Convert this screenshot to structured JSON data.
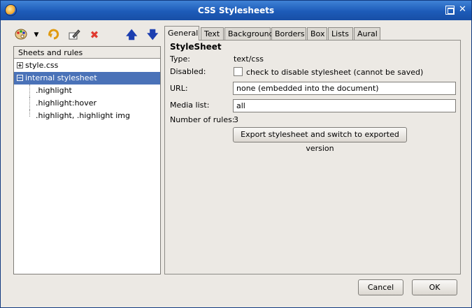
{
  "window": {
    "title": "CSS Stylesheets"
  },
  "toolbar": {
    "icons": [
      "palette-icon",
      "dropdown-arrow-icon",
      "reload-icon",
      "edit-icon",
      "delete-icon",
      "move-up-icon",
      "move-down-icon"
    ]
  },
  "tree": {
    "header": "Sheets and rules",
    "items": [
      {
        "label": "style.css",
        "expander": "+",
        "selected": false
      },
      {
        "label": "internal stylesheet",
        "expander": "−",
        "selected": true
      },
      {
        "label": ".highlight"
      },
      {
        "label": ".highlight:hover"
      },
      {
        "label": ".highlight, .highlight img"
      }
    ]
  },
  "tabs": [
    "General",
    "Text",
    "Background",
    "Borders",
    "Box",
    "Lists",
    "Aural"
  ],
  "active_tab": "General",
  "general": {
    "heading": "StyleSheet",
    "type_label": "Type:",
    "type_value": "text/css",
    "disabled_label": "Disabled:",
    "disabled_checkbox_text": "check to disable stylesheet (cannot be saved)",
    "url_label": "URL:",
    "url_value": "none (embedded into the document)",
    "media_label": "Media list:",
    "media_value": "all",
    "rules_label": "Number of rules:",
    "rules_value": "3",
    "export_button": "Export stylesheet and switch to exported version"
  },
  "footer": {
    "cancel": "Cancel",
    "ok": "OK"
  }
}
